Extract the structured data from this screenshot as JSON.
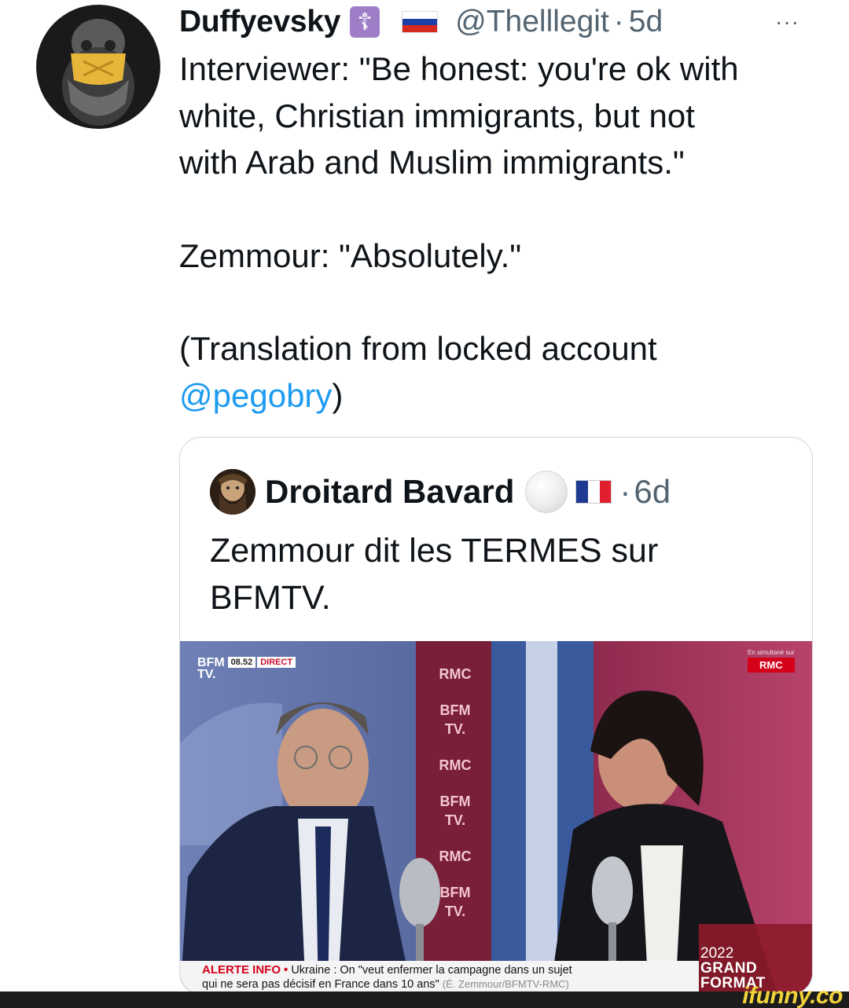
{
  "tweet": {
    "author": {
      "display_name": "Duffyevsky",
      "badge_icon": "orthodox-cross-icon",
      "badge_color": "#9e7fc7",
      "flag": "russia-flag",
      "handle": "@Thelllegit",
      "separator": "·",
      "time_ago": "5d"
    },
    "more_label": "···",
    "body": {
      "line1": "Interviewer: \"Be honest: you're ok with\nwhite, Christian immigrants, but not\nwith Arab and Muslim immigrants.\"",
      "line2": "Zemmour: \"Absolutely.\"",
      "line3": "(Translation from locked account",
      "mention": "@pegobry",
      "line3_close": ")"
    },
    "accent_color": "#1d9bf0"
  },
  "quote": {
    "author": {
      "display_name": "Droitard Bavard",
      "badge": "white-circle",
      "flag": "france-flag",
      "separator": "·",
      "time_ago": "6d"
    },
    "text": "Zemmour dit les TERMES sur\nBFMTV.",
    "video": {
      "corner_channel": "BFM\nTV.",
      "corner_time": "08.52",
      "corner_direct": "DIRECT",
      "rmc_small": "En simultané sur",
      "rmc_logo": "RMC",
      "wall_logos": [
        "RMC",
        "BFM TV.",
        "RMC",
        "BFM TV.",
        "RMC",
        "BFM TV."
      ],
      "ticker_alert": "ALERTE INFO",
      "ticker_bullet": "•",
      "ticker_text1": "Ukraine : On \"veut enfermer la campagne dans un sujet",
      "ticker_text2": "qui ne sera pas décisif en France dans 10 ans\"",
      "ticker_source": "(É. Zemmour/BFMTV-RMC)",
      "show_year": "2022",
      "show_name1": "GRAND",
      "show_name2": "FORMAT"
    }
  },
  "watermark": "ifunny.co"
}
